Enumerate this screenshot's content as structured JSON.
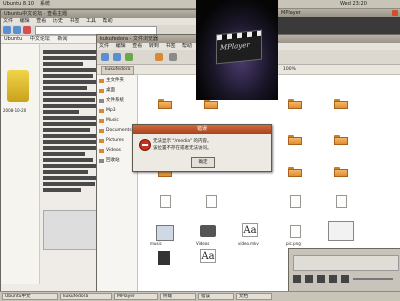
{
  "top_panel": {
    "applications": "Ubuntu 8.10",
    "places": "系统",
    "clock": "Wed 23:20"
  },
  "browser": {
    "title": "Ubuntu中文论坛 · 查看主题",
    "menu": [
      "文件",
      "编辑",
      "查看",
      "历史",
      "书签",
      "工具",
      "帮助"
    ],
    "links": [
      "Ubuntu",
      "中文论坛",
      "新闻"
    ],
    "sidebar_date": "2008-10-20"
  },
  "file_manager": {
    "title": "kukufedora - 文件浏览器",
    "menu": [
      "文件",
      "编辑",
      "查看",
      "转到",
      "书签",
      "帮助"
    ],
    "location": "kukufedora",
    "zoom": "100%",
    "sidebar": [
      "主文件夹",
      "桌面",
      "文件系统",
      "Mp3",
      "Music",
      "Documents",
      "Pictures",
      "Videos",
      "回收站"
    ],
    "file_captions": [
      "music",
      "Videos",
      "video.mkv",
      "pic.png"
    ]
  },
  "mplayer": {
    "title": "MPlayer",
    "logo_text": "MPlayer",
    "controls": [
      "play",
      "pause",
      "stop",
      "prev",
      "next",
      "fullscreen"
    ]
  },
  "dialog": {
    "title": "错误",
    "message_line1": "无法显示 \"/media\" 的内容。",
    "message_line2": "该位置不存在或者无法访问。",
    "ok_label": "确定"
  },
  "taskbar": {
    "items": [
      "Ubuntu中文",
      "kukufedora",
      "MPlayer",
      "终端",
      "错误",
      "文档"
    ]
  }
}
